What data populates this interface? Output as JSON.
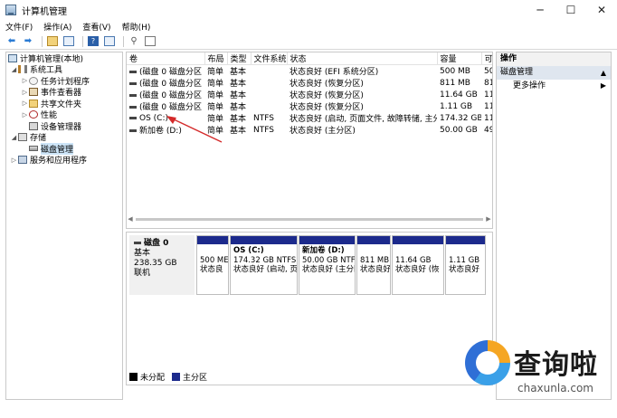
{
  "window": {
    "title": "计算机管理",
    "minimize": "─",
    "maximize": "☐",
    "close": "✕"
  },
  "menu": [
    "文件(F)",
    "操作(A)",
    "查看(V)",
    "帮助(H)"
  ],
  "tree": {
    "root": "计算机管理(本地)",
    "system_tools": "系统工具",
    "task_scheduler": "任务计划程序",
    "event_viewer": "事件查看器",
    "shared_folders": "共享文件夹",
    "performance": "性能",
    "device_manager": "设备管理器",
    "storage": "存储",
    "disk_management": "磁盘管理",
    "services_apps": "服务和应用程序"
  },
  "volumes": {
    "headers": [
      "卷",
      "布局",
      "类型",
      "文件系统",
      "状态",
      "容量",
      "可"
    ],
    "rows": [
      [
        "(磁盘 0 磁盘分区 1)",
        "简单",
        "基本",
        "",
        "状态良好 (EFI 系统分区)",
        "500 MB",
        "50"
      ],
      [
        "(磁盘 0 磁盘分区 5)",
        "简单",
        "基本",
        "",
        "状态良好 (恢复分区)",
        "811 MB",
        "81"
      ],
      [
        "(磁盘 0 磁盘分区 6)",
        "简单",
        "基本",
        "",
        "状态良好 (恢复分区)",
        "11.64 GB",
        "11"
      ],
      [
        "(磁盘 0 磁盘分区 7)",
        "简单",
        "基本",
        "",
        "状态良好 (恢复分区)",
        "1.11 GB",
        "11"
      ],
      [
        "OS (C:)",
        "简单",
        "基本",
        "NTFS",
        "状态良好 (启动, 页面文件, 故障转储, 主分区)",
        "174.32 GB",
        "11"
      ],
      [
        "新加卷 (D:)",
        "简单",
        "基本",
        "NTFS",
        "状态良好 (主分区)",
        "50.00 GB",
        "49"
      ]
    ]
  },
  "disk": {
    "name": "磁盘 0",
    "type": "基本",
    "size": "238.35 GB",
    "status": "联机",
    "partitions": [
      {
        "name": "",
        "line1": "500 ME",
        "line2": "状态良"
      },
      {
        "name": "OS  (C:)",
        "line1": "174.32 GB NTFS",
        "line2": "状态良好 (启动, 页"
      },
      {
        "name": "新加卷  (D:)",
        "line1": "50.00 GB NTFS",
        "line2": "状态良好 (主分区"
      },
      {
        "name": "",
        "line1": "811 MB",
        "line2": "状态良好"
      },
      {
        "name": "",
        "line1": "11.64 GB",
        "line2": "状态良好 (恢"
      },
      {
        "name": "",
        "line1": "1.11 GB",
        "line2": "状态良好"
      }
    ]
  },
  "legend": {
    "unallocated": "未分配",
    "primary": "主分区",
    "unallocated_color": "#000000",
    "primary_color": "#1c2a8c"
  },
  "actions": {
    "header": "操作",
    "section": "磁盘管理",
    "more": "更多操作"
  },
  "watermark": {
    "title": "查询啦",
    "url": "chaxunla.com"
  }
}
